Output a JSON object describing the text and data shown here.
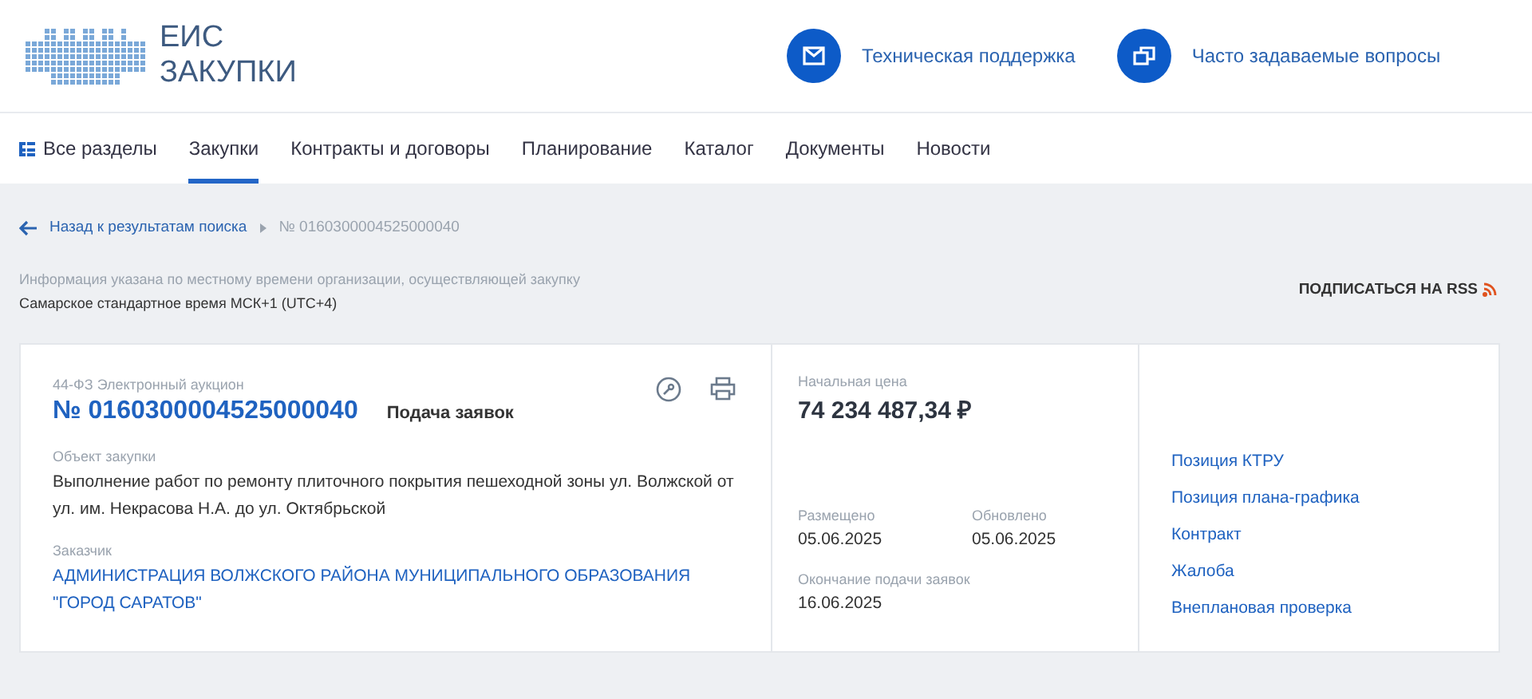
{
  "header": {
    "logo_top": "ЕИС",
    "logo_bottom": "ЗАКУПКИ",
    "links": [
      {
        "kind": "mail",
        "label": "Техническая поддержка"
      },
      {
        "kind": "windows",
        "label": "Часто задаваемые вопросы"
      }
    ]
  },
  "nav": {
    "all_sections": "Все разделы",
    "tabs": [
      {
        "label": "Закупки",
        "selected": true
      },
      {
        "label": "Контракты и договоры",
        "selected": false
      },
      {
        "label": "Планирование",
        "selected": false
      },
      {
        "label": "Каталог",
        "selected": false
      },
      {
        "label": "Документы",
        "selected": false
      },
      {
        "label": "Новости",
        "selected": false
      }
    ]
  },
  "breadcrumb": {
    "back": "Назад к результатам поиска",
    "current": "№ 0160300004525000040"
  },
  "timezone": {
    "note": "Информация указана по местному времени организации, осуществляющей закупку",
    "value": "Самарское стандартное время МСК+1 (UTC+4)"
  },
  "rss": "ПОДПИСАТЬСЯ НА RSS",
  "card": {
    "law": "44-ФЗ",
    "method": "Электронный аукцион",
    "number": "№ 0160300004525000040",
    "stage": "Подача заявок",
    "object_label": "Объект закупки",
    "object": "Выполнение работ по ремонту плиточного покрытия пешеходной зоны ул. Волжской от ул. им. Некрасова Н.А. до ул. Октябрьской",
    "customer_label": "Заказчик",
    "customer": "АДМИНИСТРАЦИЯ ВОЛЖСКОГО РАЙОНА МУНИЦИПАЛЬНОГО ОБРАЗОВАНИЯ \"ГОРОД САРАТОВ\"",
    "price_label": "Начальная цена",
    "price": "74 234 487,34 ₽",
    "dates": [
      {
        "label": "Размещено",
        "value": "05.06.2025"
      },
      {
        "label": "Обновлено",
        "value": "05.06.2025"
      },
      {
        "label": "Окончание подачи заявок",
        "value": "16.06.2025"
      }
    ],
    "links": [
      "Позиция КТРУ",
      "Позиция плана-графика",
      "Контракт",
      "Жалоба",
      "Внеплановая проверка"
    ]
  }
}
